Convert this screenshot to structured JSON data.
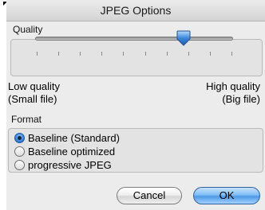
{
  "dialog": {
    "title": "JPEG Options"
  },
  "quality": {
    "group_label": "Quality",
    "slider_value_fraction": 0.75,
    "tick_count": 10,
    "min_label_line1": "Low quality",
    "min_label_line2": "(Small file)",
    "max_label_line1": "High quality",
    "max_label_line2": "(Big file)"
  },
  "format": {
    "group_label": "Format",
    "options": [
      {
        "label": "Baseline (Standard)",
        "selected": true
      },
      {
        "label": "Baseline optimized",
        "selected": false
      },
      {
        "label": "progressive JPEG",
        "selected": false
      }
    ]
  },
  "buttons": {
    "cancel_label": "Cancel",
    "ok_label": "OK"
  },
  "colors": {
    "default_button": "#4e98e6",
    "selected_radio": "#3b86da",
    "slider_thumb": "#3b86da"
  }
}
